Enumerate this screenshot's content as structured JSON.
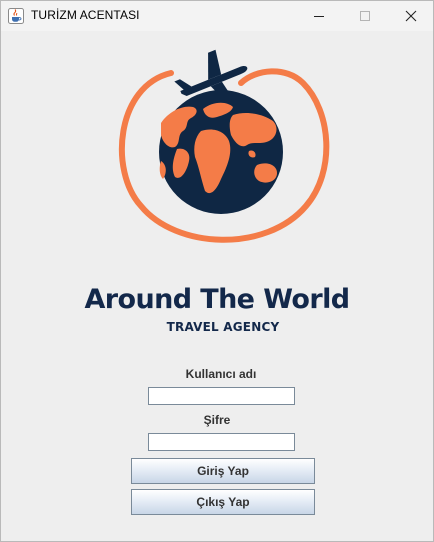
{
  "window": {
    "title": "TURİZM ACENTASI",
    "app_icon": "java-coffee-cup-icon",
    "controls": [
      "minimize-icon",
      "maximize-icon",
      "close-icon"
    ]
  },
  "logo": {
    "title": "Around The World",
    "subtitle": "TRAVEL AGENCY",
    "graphic": "globe-with-orbiting-airplane",
    "colors": {
      "navy": "#0f2744",
      "orange": "#f47c48"
    }
  },
  "form": {
    "username_label": "Kullanıcı adı",
    "username_value": "",
    "password_label": "Şifre",
    "password_value": "",
    "login_button": "Giriş Yap",
    "exit_button": "Çıkış Yap"
  }
}
